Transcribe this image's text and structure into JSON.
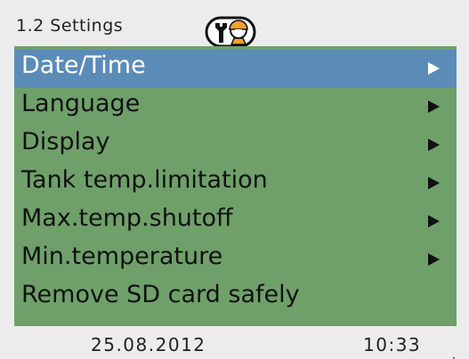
{
  "header": {
    "title": "1.2 Settings",
    "icon": "service-technician-icon"
  },
  "menu": {
    "selected_index": 0,
    "items": [
      {
        "label": "Date/Time",
        "has_submenu": true
      },
      {
        "label": "Language",
        "has_submenu": true
      },
      {
        "label": "Display",
        "has_submenu": true
      },
      {
        "label": "Tank temp.limitation",
        "has_submenu": true
      },
      {
        "label": "Max.temp.shutoff",
        "has_submenu": true
      },
      {
        "label": "Min.temperature",
        "has_submenu": true
      },
      {
        "label": "Remove SD card safely",
        "has_submenu": false
      }
    ],
    "more_below": true
  },
  "footer": {
    "date": "25.08.2012",
    "time": "10:33"
  },
  "colors": {
    "background": "#ececec",
    "menu_background": "#6fa06a",
    "selection": "#5b8cb8",
    "icon_accent": "#f0a030"
  }
}
